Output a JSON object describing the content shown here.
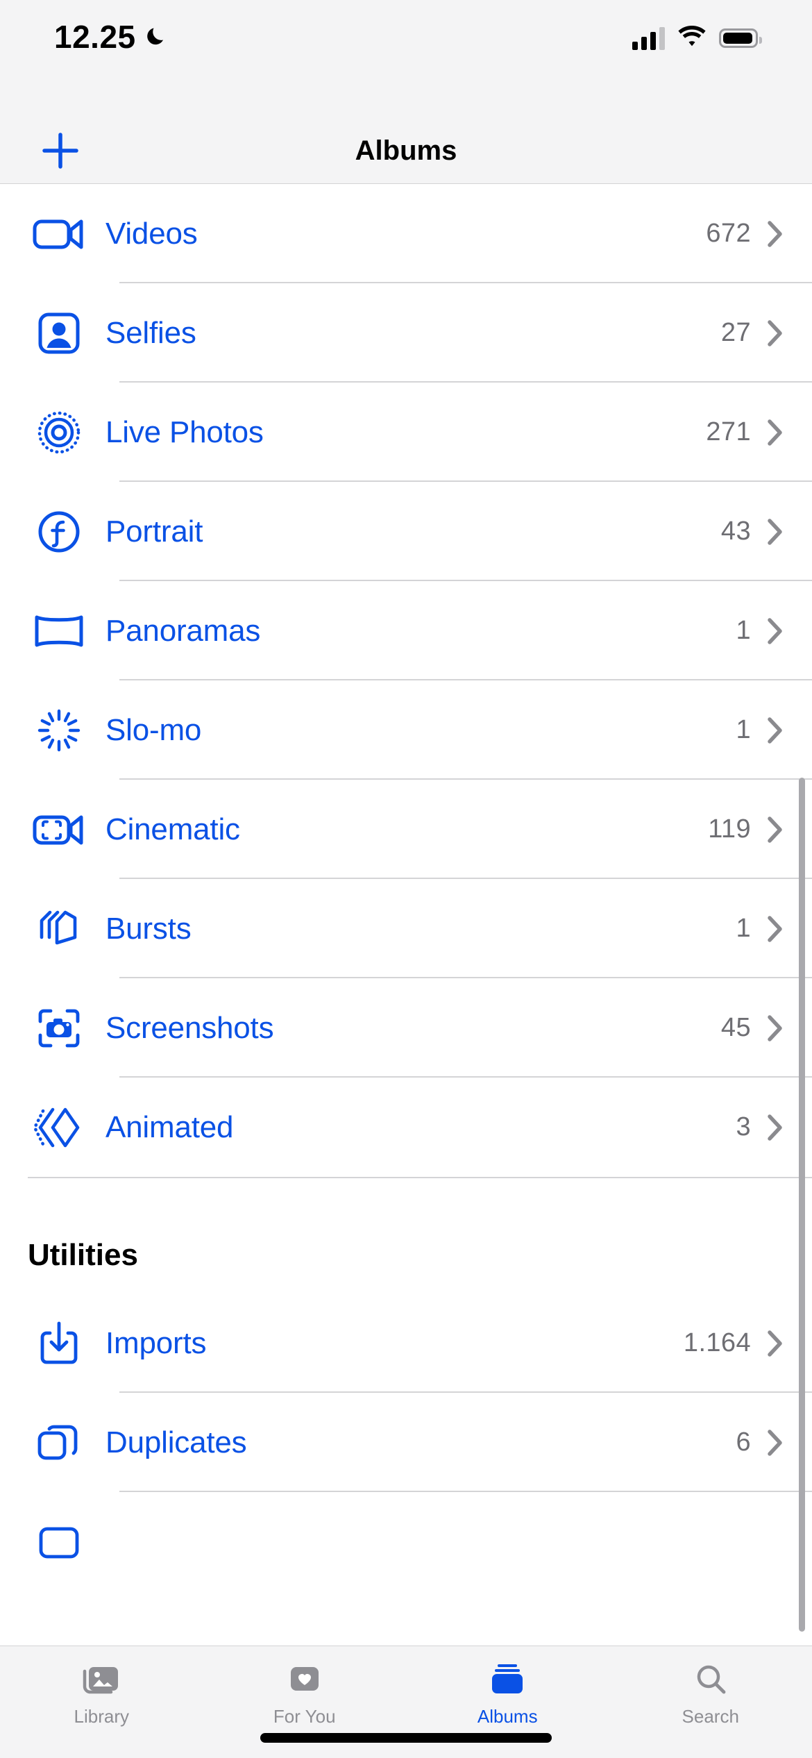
{
  "status_bar": {
    "time": "12.25",
    "dnd_icon": "moon-icon",
    "cellular_icon": "cellular-signal-icon",
    "wifi_icon": "wifi-icon",
    "battery_icon": "battery-icon"
  },
  "nav_bar": {
    "title": "Albums",
    "add_button_label": "+",
    "add_icon": "plus-icon"
  },
  "colors": {
    "accent": "#0a51e5",
    "count_text": "#6e6e73",
    "separator": "#d4d4d6",
    "chrome_bg": "#f4f4f5",
    "inactive_tab": "#8e8e93"
  },
  "media_types": {
    "rows": [
      {
        "label": "Videos",
        "count": "672",
        "icon": "video-camera-icon"
      },
      {
        "label": "Selfies",
        "count": "27",
        "icon": "person-portrait-icon"
      },
      {
        "label": "Live Photos",
        "count": "271",
        "icon": "live-photo-icon"
      },
      {
        "label": "Portrait",
        "count": "43",
        "icon": "aperture-f-icon"
      },
      {
        "label": "Panoramas",
        "count": "1",
        "icon": "panorama-icon"
      },
      {
        "label": "Slo-mo",
        "count": "1",
        "icon": "slow-motion-icon"
      },
      {
        "label": "Cinematic",
        "count": "119",
        "icon": "cinematic-video-icon"
      },
      {
        "label": "Bursts",
        "count": "1",
        "icon": "burst-stack-icon"
      },
      {
        "label": "Screenshots",
        "count": "45",
        "icon": "screenshot-camera-icon"
      },
      {
        "label": "Animated",
        "count": "3",
        "icon": "animated-diamond-icon"
      }
    ]
  },
  "utilities": {
    "header": "Utilities",
    "rows": [
      {
        "label": "Imports",
        "count": "1.164",
        "icon": "import-tray-icon"
      },
      {
        "label": "Duplicates",
        "count": "6",
        "icon": "duplicate-squares-icon"
      }
    ]
  },
  "tab_bar": {
    "tabs": [
      {
        "label": "Library",
        "icon": "photos-library-icon",
        "active": false
      },
      {
        "label": "For You",
        "icon": "heart-card-icon",
        "active": false
      },
      {
        "label": "Albums",
        "icon": "albums-stack-icon",
        "active": true
      },
      {
        "label": "Search",
        "icon": "search-icon",
        "active": false
      }
    ]
  }
}
